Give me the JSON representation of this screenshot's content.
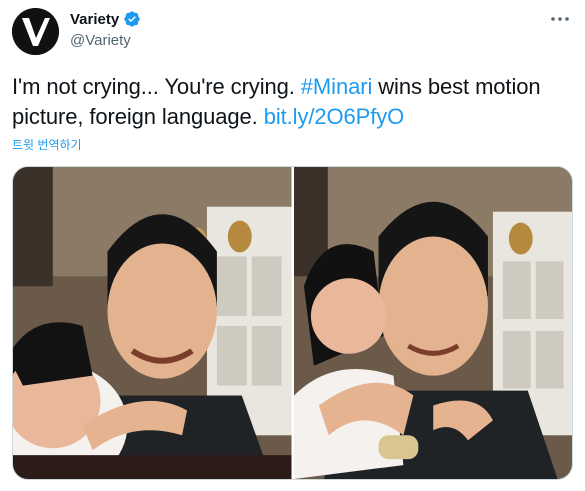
{
  "author": {
    "display_name": "Variety",
    "handle": "@Variety",
    "verified": true,
    "avatar_icon": "variety-logo-icon",
    "avatar_color": "#111111"
  },
  "tweet": {
    "text_plain_1": "I'm not crying... You're crying. ",
    "hashtag": "#Minari",
    "text_plain_2": " wins best motion picture, foreign language. ",
    "link": "bit.ly/2O6PfyO",
    "translate_label": "트윗 번역하기"
  },
  "media": {
    "photos": [
      {
        "alt": "photo-1"
      },
      {
        "alt": "photo-2"
      }
    ]
  },
  "colors": {
    "accent": "#1d9bf0",
    "text": "#0f1419",
    "muted": "#536471"
  },
  "icons": {
    "verified": "verified-badge-icon",
    "more": "more-options-icon"
  }
}
